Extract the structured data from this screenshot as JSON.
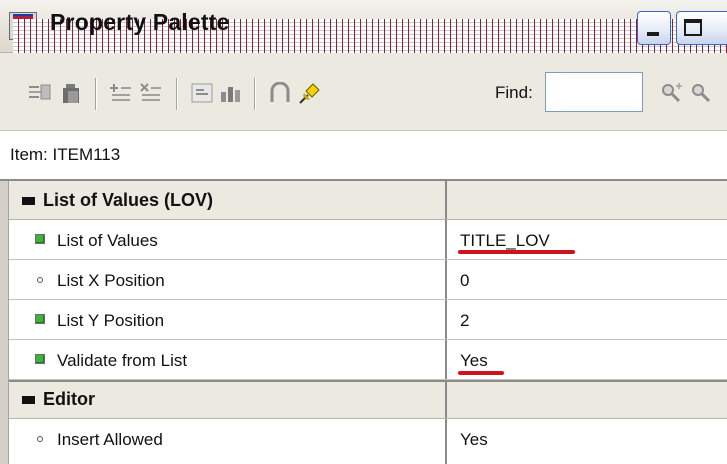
{
  "window": {
    "title": "Property Palette",
    "title_icon": "property-palette-app-icon",
    "controls": [
      "minimize-icon",
      "maximize-icon"
    ]
  },
  "toolbar": {
    "icons": [
      "copy-properties-icon",
      "paste-properties-icon",
      "add-property-icon",
      "delete-property-icon",
      "inherit-property-icon",
      "property-class-icon",
      "intersection-union-icon",
      "pin-icon",
      "find-previous-icon",
      "find-next-icon"
    ],
    "find_label": "Find:",
    "find_value": ""
  },
  "item": {
    "label": "Item: ITEM113"
  },
  "groups": [
    {
      "title": "List of Values (LOV)",
      "collapse_icon": "collapse-icon",
      "properties": [
        {
          "name": "List of Values",
          "value": "TITLE_LOV",
          "marker": "changed-property-icon",
          "underlined": true
        },
        {
          "name": "List X Position",
          "value": "0",
          "marker": "default-property-icon",
          "underlined": false
        },
        {
          "name": "List Y Position",
          "value": "2",
          "marker": "changed-property-icon",
          "underlined": false
        },
        {
          "name": "Validate from List",
          "value": "Yes",
          "marker": "changed-property-icon",
          "underlined": true
        }
      ]
    },
    {
      "title": "Editor",
      "collapse_icon": "collapse-icon",
      "properties": [
        {
          "name": "Insert Allowed",
          "value": "Yes",
          "marker": "default-property-icon",
          "underlined": false
        }
      ]
    }
  ],
  "colors": {
    "annotation_underline": "#d0121b",
    "changed_marker": "#3fb13f",
    "window_button_border": "#3a64c4"
  }
}
